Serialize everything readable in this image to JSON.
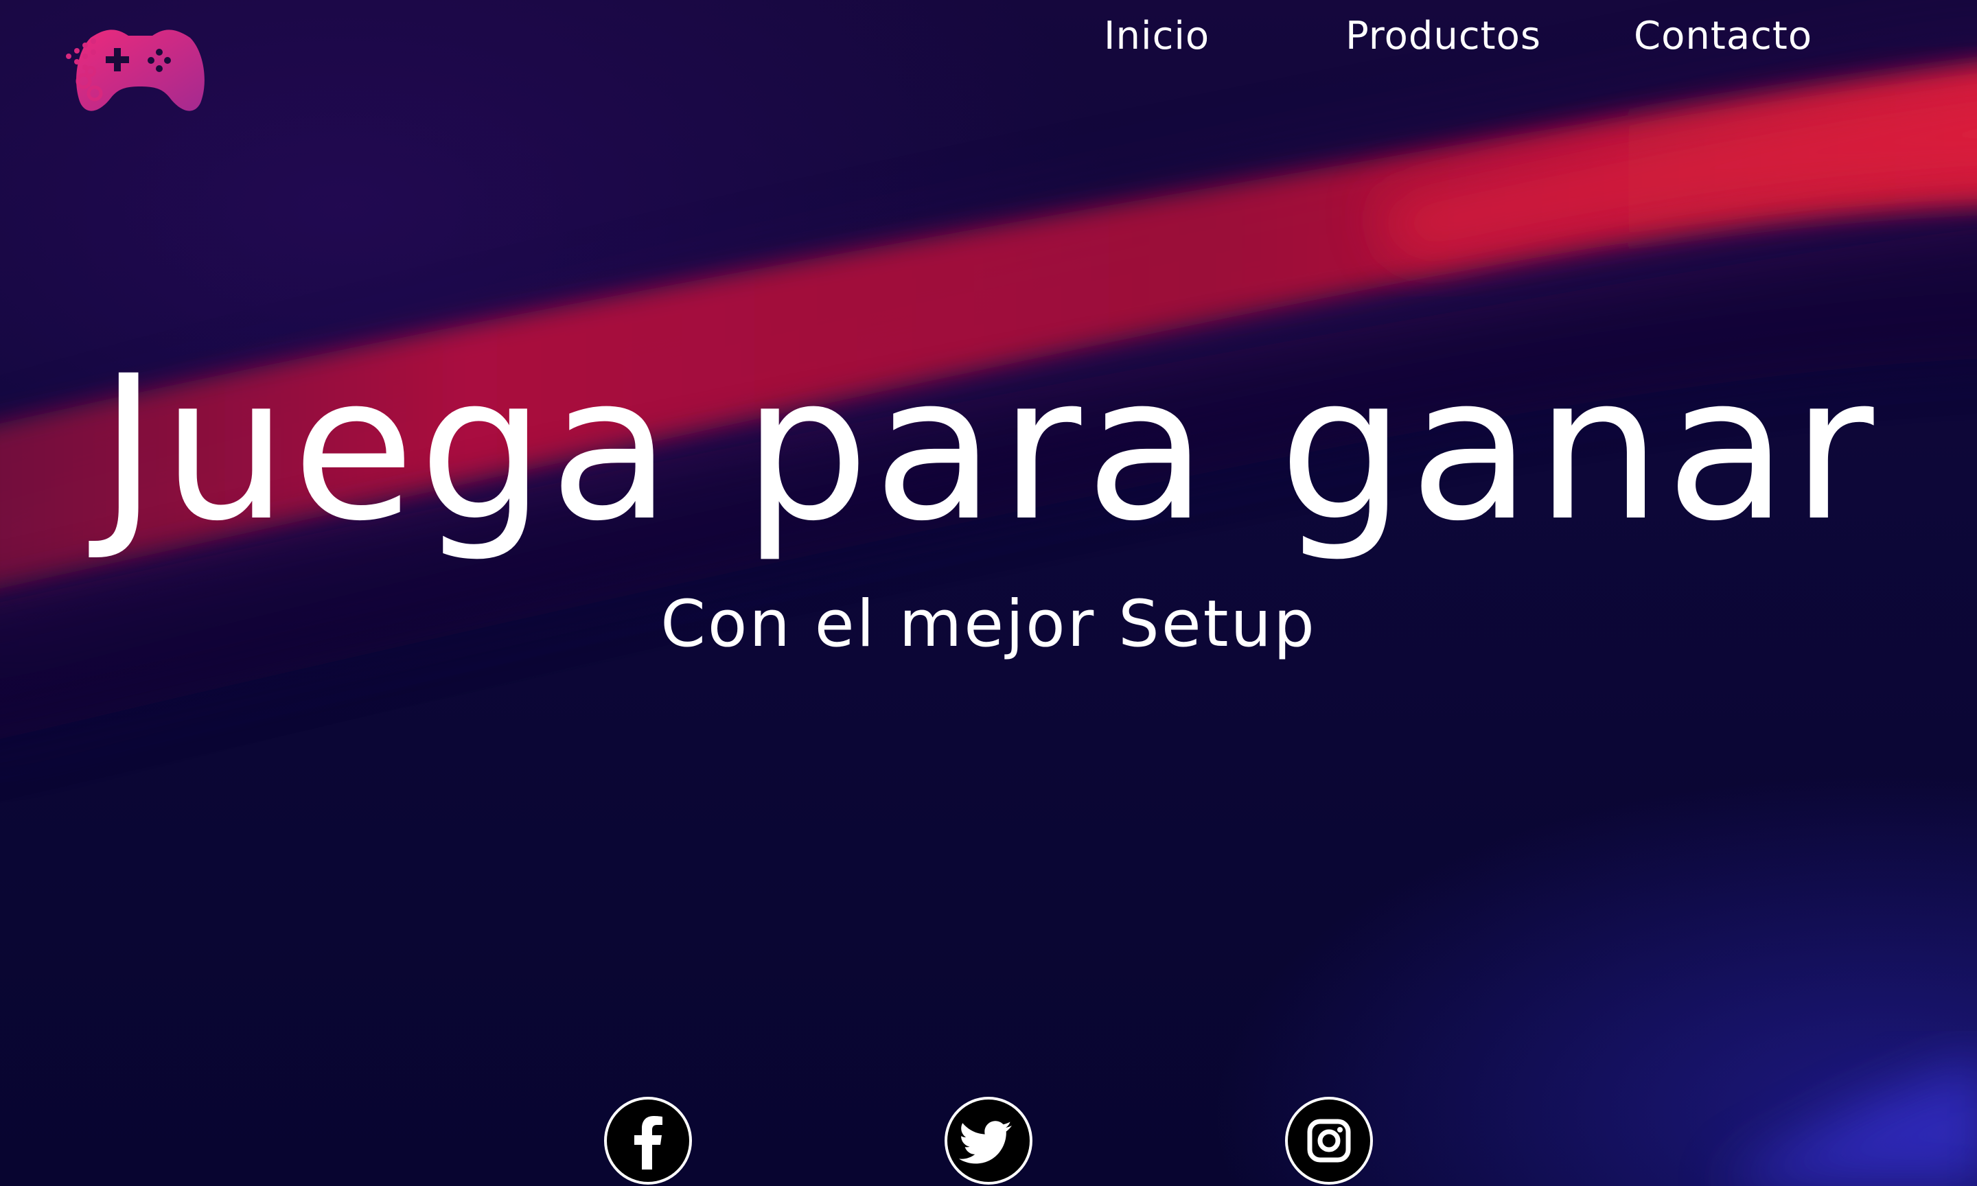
{
  "header": {
    "logo_icon": "gamepad-icon",
    "logo_colors": [
      "#e0287a",
      "#b02a8c"
    ],
    "nav": [
      {
        "label": "Inicio"
      },
      {
        "label": "Productos"
      },
      {
        "label": "Contacto"
      }
    ]
  },
  "hero": {
    "title": "Juega para ganar",
    "subtitle": "Con el mejor Setup"
  },
  "social": [
    {
      "icon": "facebook-icon"
    },
    {
      "icon": "twitter-icon"
    },
    {
      "icon": "instagram-icon"
    }
  ],
  "colors": {
    "background": "#0b0636",
    "accent_band": "#c0143c",
    "text": "#ffffff",
    "glow_blue": "#2d28be"
  }
}
